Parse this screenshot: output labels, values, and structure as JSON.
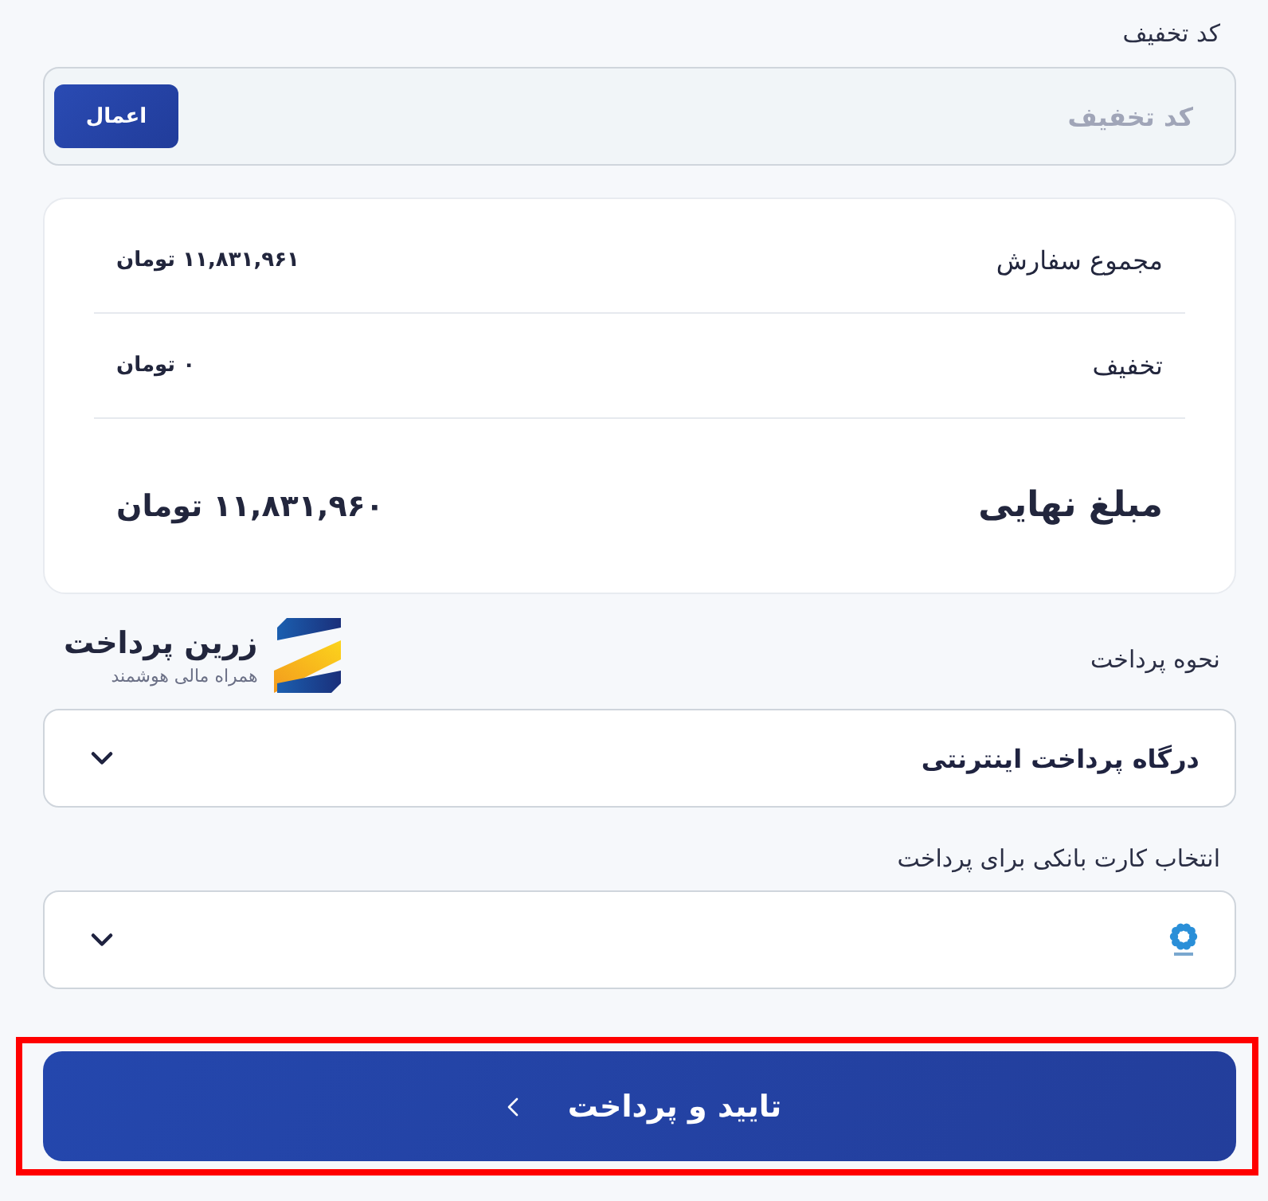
{
  "discount": {
    "label": "کد تخفیف",
    "placeholder": "کد تخفیف",
    "button": "اعمال"
  },
  "summary": {
    "rows": [
      {
        "kind": "item",
        "label": "مجموع سفارش",
        "value": "۱۱,۸۳۱,۹۶۱ تومان"
      },
      {
        "kind": "item",
        "label": "تخفیف",
        "value": "۰ تومان"
      },
      {
        "kind": "total",
        "label": "مبلغ نهایی",
        "value": "۱۱,۸۳۱,۹۶۰ تومان"
      }
    ]
  },
  "brand": {
    "name": "زرین پرداخت",
    "tagline": "همراه مالی هوشمند"
  },
  "payment_method": {
    "label": "نحوه پرداخت",
    "value": "درگاه پرداخت اینترنتی"
  },
  "bank_card": {
    "label": "انتخاب کارت بانکی برای پرداخت"
  },
  "confirm_button": {
    "label": "تایید و پرداخت",
    "highlighted": true
  }
}
